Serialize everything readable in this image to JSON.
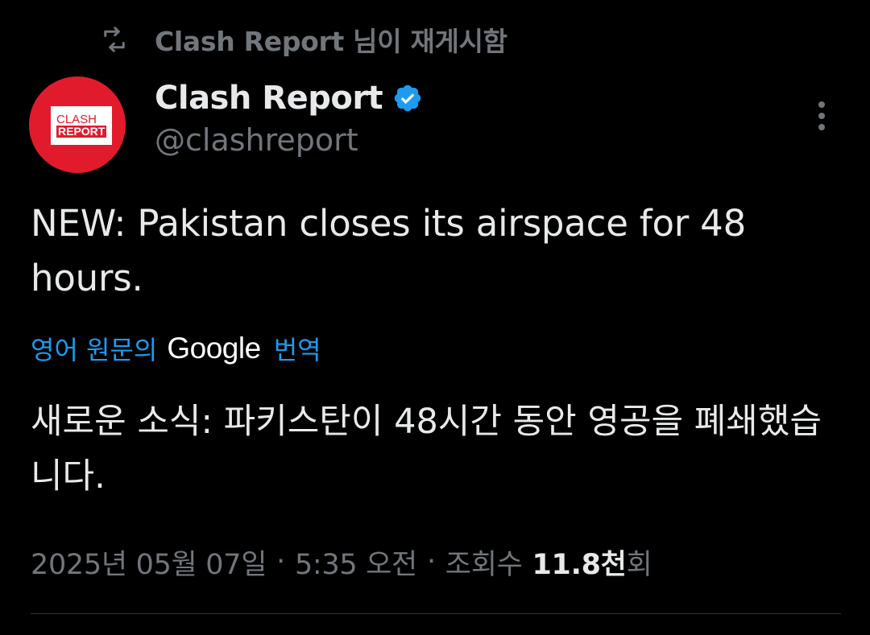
{
  "retweet": {
    "icon": "retweet-icon",
    "label": "Clash Report 님이 재게시함"
  },
  "author": {
    "name": "Clash Report",
    "handle": "@clashreport",
    "verified": true,
    "verified_color": "#1d9bf0",
    "avatar": {
      "logo_line1": "CLASH",
      "logo_line2": "REPORT",
      "brand_color": "#e21b2c"
    }
  },
  "more_icon": "more-vertical-icon",
  "tweet": {
    "text": "NEW: Pakistan closes its airspace for 48 hours."
  },
  "translation": {
    "prefix": "영어 원문의",
    "provider": "Google",
    "suffix": "번역",
    "text": "새로운 소식: 파키스탄이 48시간 동안 영공을 폐쇄했습니다."
  },
  "meta": {
    "date": "2025년 05월 07일",
    "separator": "·",
    "time": "5:35 오전",
    "views_label": "조회수",
    "views_count": "11.8천",
    "views_unit": "회"
  },
  "colors": {
    "background": "#000000",
    "primary_text": "#e7e9ea",
    "secondary_text": "#71767b",
    "link": "#1d9bf0"
  }
}
